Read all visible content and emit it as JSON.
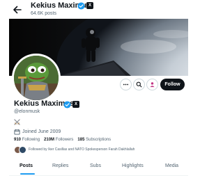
{
  "header": {
    "display_name": "Kekius Maximus",
    "posts_count": "64.6K posts",
    "back_icon": "arrow-left-icon"
  },
  "profile": {
    "display_name": "Kekius Maximus",
    "handle": "@elonmusk",
    "bio_icon": "crossed-swords-icon",
    "joined": "Joined June 2009",
    "following_count": "910",
    "following_label": "Following",
    "followers_count": "210M",
    "followers_label": "Followers",
    "subscriptions_count": "185",
    "subscriptions_label": "Subscriptions",
    "followed_by": "Followed by Iker Casillas and NATO Spokesperson Farah Dakhlallah"
  },
  "actions": {
    "more_icon": "more-horizontal-icon",
    "search_icon": "search-icon",
    "subscribe_icon": "person-icon",
    "follow_label": "Follow"
  },
  "tabs": [
    {
      "label": "Posts"
    },
    {
      "label": "Replies"
    },
    {
      "label": "Subs"
    },
    {
      "label": "Highlights"
    },
    {
      "label": "Media"
    }
  ],
  "colors": {
    "accent": "#1d9bf0",
    "text_primary": "#0f1419",
    "text_secondary": "#536471",
    "verified": "#1d9bf0",
    "follow_button_bg": "#0f1419",
    "subscribe_icon": "#c13584"
  }
}
